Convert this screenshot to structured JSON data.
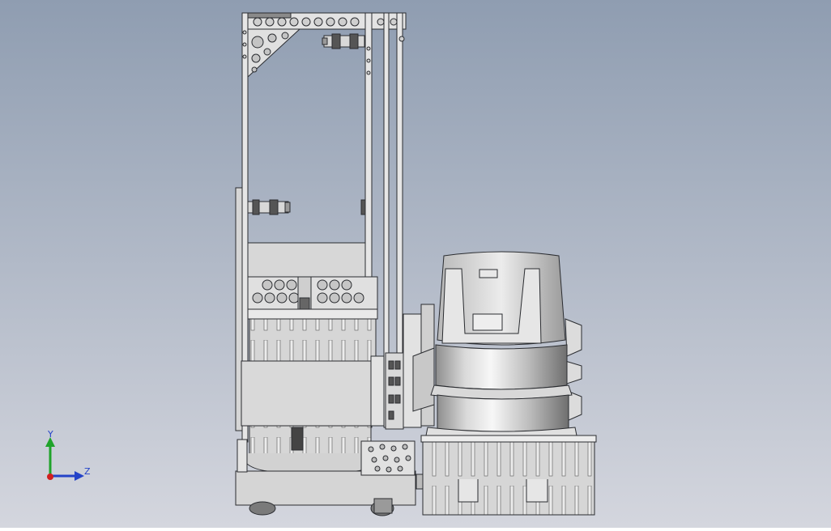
{
  "viewport": {
    "background_top": "#8f9db1",
    "background_bottom": "#d4d6de"
  },
  "model": {
    "line_color": "#2a2c30",
    "metal_light": "#e6e6e6",
    "metal_mid": "#cfcfcf",
    "metal_dark": "#9c9c9c"
  },
  "triad": {
    "y_label": "Y",
    "z_label": "Z",
    "y_color": "#1fa32a",
    "z_color": "#2443c8",
    "x_color": "#d11f1f"
  }
}
